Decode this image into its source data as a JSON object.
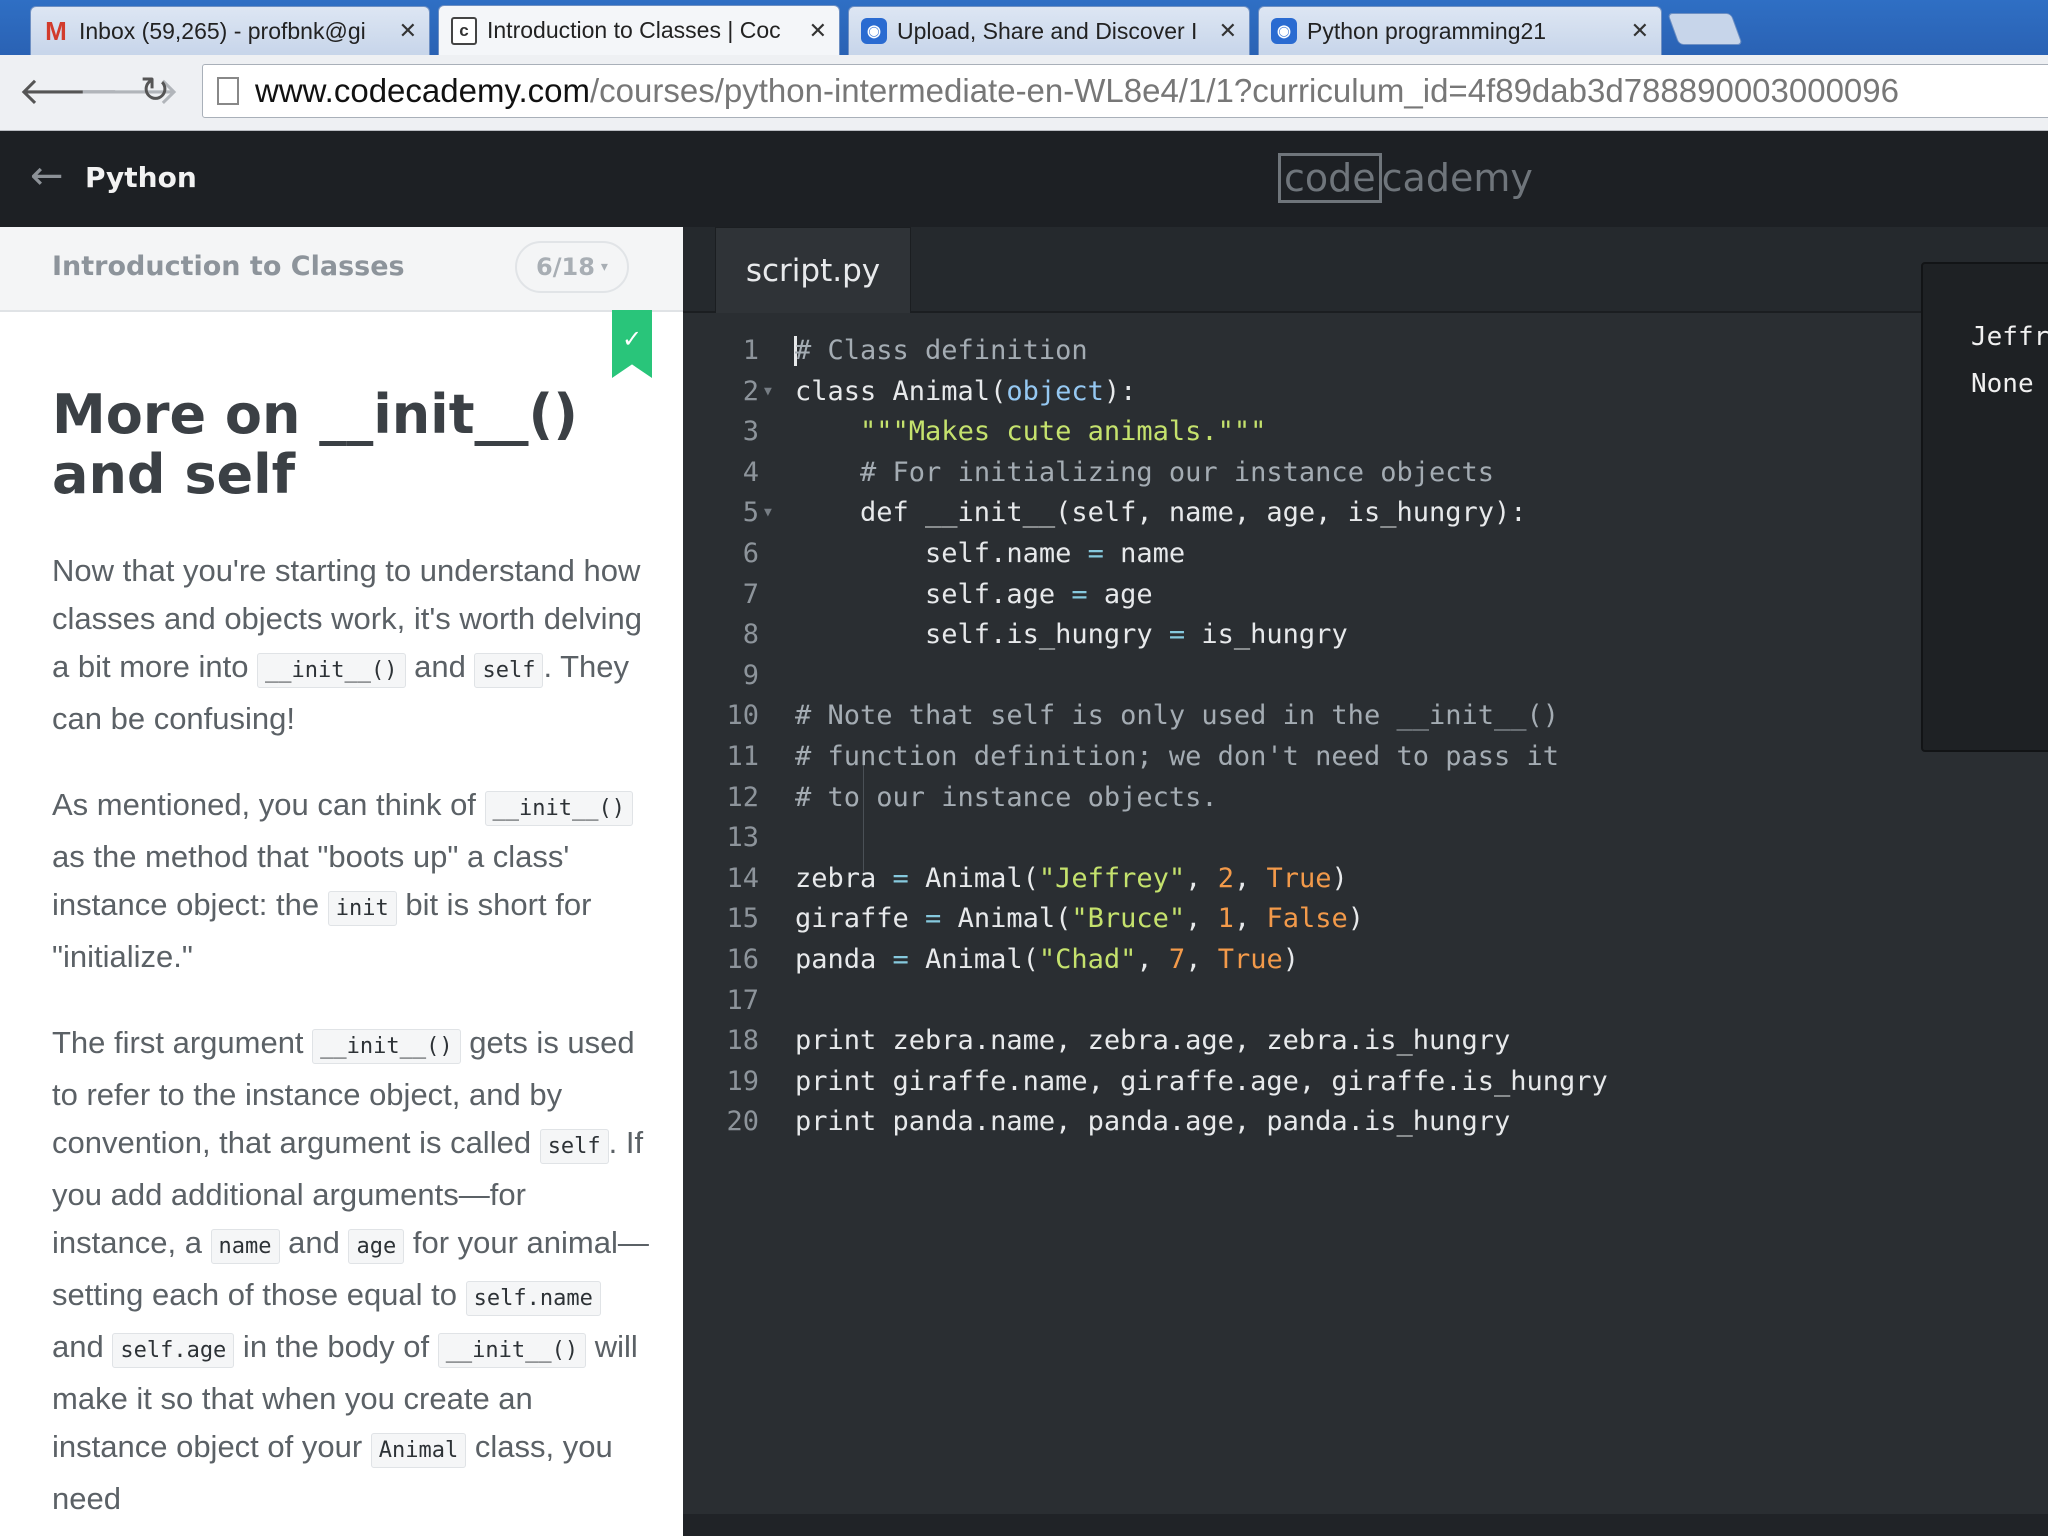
{
  "browser": {
    "tabs": [
      {
        "title": "Inbox (59,265) - profbnk@gi",
        "favicon": "gmail-icon",
        "active": false
      },
      {
        "title": "Introduction to Classes | Coc",
        "favicon": "codecademy-icon",
        "active": true
      },
      {
        "title": "Upload, Share and Discover I",
        "favicon": "screencast-icon",
        "active": false
      },
      {
        "title": "Python programming21",
        "favicon": "screencast-icon",
        "active": false
      }
    ],
    "close_glyph": "✕",
    "url_host": "www.codecademy.com",
    "url_path": "/courses/python-intermediate-en-WL8e4/1/1?curriculum_id=4f89dab3d788890003000096"
  },
  "header": {
    "back_glyph": "←",
    "course_name": "Python",
    "logo_box": "code",
    "logo_rest": "cademy"
  },
  "lesson": {
    "unit_name": "Introduction to Classes",
    "progress": "6/18",
    "progress_caret": "▾",
    "completed_check": "✓",
    "title": "More on __init__() and self",
    "p1": [
      "Now that you're starting to understand how classes and objects work, it's worth delving a bit more into ",
      "__init__()",
      " and ",
      "self",
      ". They can be confusing!"
    ],
    "p2": [
      "As mentioned, you can think of ",
      "__init__()",
      " as the method that \"boots up\" a class' instance object: the ",
      "init",
      " bit is short for \"initialize.\""
    ],
    "p3": [
      "The first argument ",
      "__init__()",
      " gets is used to refer to the instance object, and by convention, that argument is called ",
      "self",
      ". If you add additional arguments—for instance, a ",
      "name",
      " and ",
      "age",
      " for your animal—setting each of those equal to ",
      "self.name",
      " and ",
      "self.age",
      " in the body of ",
      "__init__()",
      " will make it so that when you create an instance object of your ",
      "Animal",
      " class, you need"
    ]
  },
  "editor": {
    "file_tab": "script.py",
    "lines": [
      {
        "n": "1",
        "fold": false,
        "text": "# Class definition"
      },
      {
        "n": "2",
        "fold": true,
        "text": "class Animal(object):"
      },
      {
        "n": "3",
        "fold": false,
        "text": "    \"\"\"Makes cute animals.\"\"\""
      },
      {
        "n": "4",
        "fold": false,
        "text": "    # For initializing our instance objects"
      },
      {
        "n": "5",
        "fold": true,
        "text": "    def __init__(self, name, age, is_hungry):"
      },
      {
        "n": "6",
        "fold": false,
        "text": "        self.name = name"
      },
      {
        "n": "7",
        "fold": false,
        "text": "        self.age = age"
      },
      {
        "n": "8",
        "fold": false,
        "text": "        self.is_hungry = is_hungry"
      },
      {
        "n": "9",
        "fold": false,
        "text": ""
      },
      {
        "n": "10",
        "fold": false,
        "text": "# Note that self is only used in the __init__()"
      },
      {
        "n": "11",
        "fold": false,
        "text": "# function definition; we don't need to pass it"
      },
      {
        "n": "12",
        "fold": false,
        "text": "# to our instance objects."
      },
      {
        "n": "13",
        "fold": false,
        "text": ""
      },
      {
        "n": "14",
        "fold": false,
        "text": "zebra = Animal(\"Jeffrey\", 2, True)"
      },
      {
        "n": "15",
        "fold": false,
        "text": "giraffe = Animal(\"Bruce\", 1, False)"
      },
      {
        "n": "16",
        "fold": false,
        "text": "panda = Animal(\"Chad\", 7, True)"
      },
      {
        "n": "17",
        "fold": false,
        "text": ""
      },
      {
        "n": "18",
        "fold": false,
        "text": "print zebra.name, zebra.age, zebra.is_hungry"
      },
      {
        "n": "19",
        "fold": false,
        "text": "print giraffe.name, giraffe.age, giraffe.is_hungry"
      },
      {
        "n": "20",
        "fold": false,
        "text": "print panda.name, panda.age, panda.is_hungry"
      }
    ]
  },
  "console": {
    "lines": [
      "Jeffr",
      "None"
    ]
  },
  "colors": {
    "accent_green": "#29c57a",
    "editor_bg": "#2a2e32",
    "header_bg": "#1d2024"
  }
}
